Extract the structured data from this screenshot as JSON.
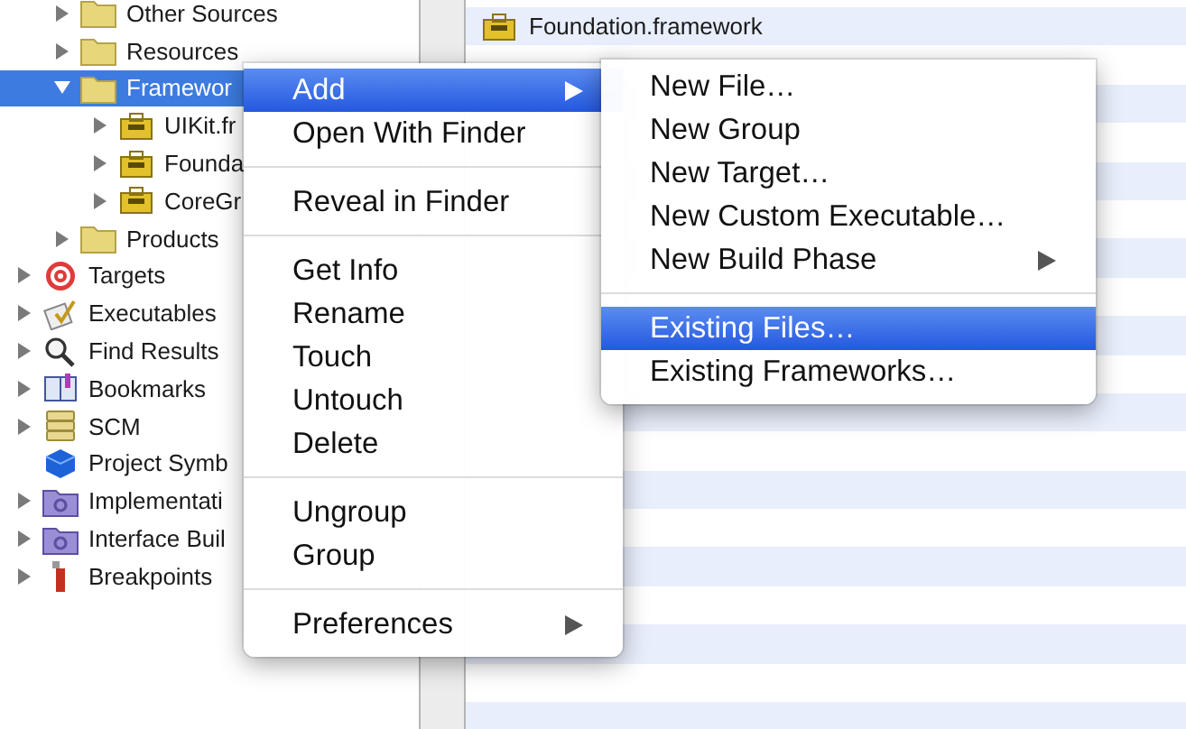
{
  "sidebar": {
    "project_children": [
      {
        "label": "Other Sources",
        "kind": "folder",
        "expanded": false,
        "selected": false
      },
      {
        "label": "Resources",
        "kind": "folder",
        "expanded": false,
        "selected": false
      },
      {
        "label": "Framewor",
        "kind": "folder",
        "expanded": true,
        "selected": true,
        "children": [
          {
            "label": "UIKit.fr",
            "kind": "framework",
            "expanded": false,
            "selected": false
          },
          {
            "label": "Founda",
            "kind": "framework",
            "expanded": false,
            "selected": false
          },
          {
            "label": "CoreGr",
            "kind": "framework",
            "expanded": false,
            "selected": false
          }
        ]
      },
      {
        "label": "Products",
        "kind": "folder",
        "expanded": false,
        "selected": false
      }
    ],
    "groups": [
      {
        "label": "Targets",
        "kind": "target",
        "expanded": false,
        "selected": false
      },
      {
        "label": "Executables",
        "kind": "executable",
        "expanded": false,
        "selected": false
      },
      {
        "label": "Find Results",
        "kind": "search",
        "expanded": false,
        "selected": false
      },
      {
        "label": "Bookmarks",
        "kind": "book",
        "expanded": false,
        "selected": false
      },
      {
        "label": "SCM",
        "kind": "database",
        "expanded": false,
        "selected": false
      },
      {
        "label": "Project Symb",
        "kind": "cube",
        "selected": false
      },
      {
        "label": "Implementati",
        "kind": "gear-folder",
        "expanded": false,
        "selected": false
      },
      {
        "label": "Interface Buil",
        "kind": "gear-folder",
        "expanded": false,
        "selected": false
      },
      {
        "label": "Breakpoints",
        "kind": "breakpoint",
        "expanded": false,
        "selected": false
      }
    ]
  },
  "files": [
    {
      "name": "Foundation.framework",
      "kind": "framework"
    }
  ],
  "context_menu": {
    "sections": [
      [
        {
          "label": "Add",
          "submenu": true,
          "selected": true
        },
        {
          "label": "Open With Finder",
          "submenu": false,
          "selected": false
        }
      ],
      [
        {
          "label": "Reveal in Finder",
          "submenu": false,
          "selected": false
        }
      ],
      [
        {
          "label": "Get Info",
          "submenu": false,
          "selected": false
        },
        {
          "label": "Rename",
          "submenu": false,
          "selected": false
        },
        {
          "label": "Touch",
          "submenu": false,
          "selected": false
        },
        {
          "label": "Untouch",
          "submenu": false,
          "selected": false
        },
        {
          "label": "Delete",
          "submenu": false,
          "selected": false
        }
      ],
      [
        {
          "label": "Ungroup",
          "submenu": false,
          "selected": false
        },
        {
          "label": "Group",
          "submenu": false,
          "selected": false
        }
      ],
      [
        {
          "label": "Preferences",
          "submenu": true,
          "selected": false
        }
      ]
    ]
  },
  "submenu": {
    "sections": [
      [
        {
          "label": "New File…",
          "submenu": false,
          "selected": false
        },
        {
          "label": "New Group",
          "submenu": false,
          "selected": false
        },
        {
          "label": "New Target…",
          "submenu": false,
          "selected": false
        },
        {
          "label": "New Custom Executable…",
          "submenu": false,
          "selected": false
        },
        {
          "label": "New Build Phase",
          "submenu": true,
          "selected": false
        }
      ],
      [
        {
          "label": "Existing Files…",
          "submenu": false,
          "selected": true
        },
        {
          "label": "Existing Frameworks…",
          "submenu": false,
          "selected": false
        }
      ]
    ]
  }
}
